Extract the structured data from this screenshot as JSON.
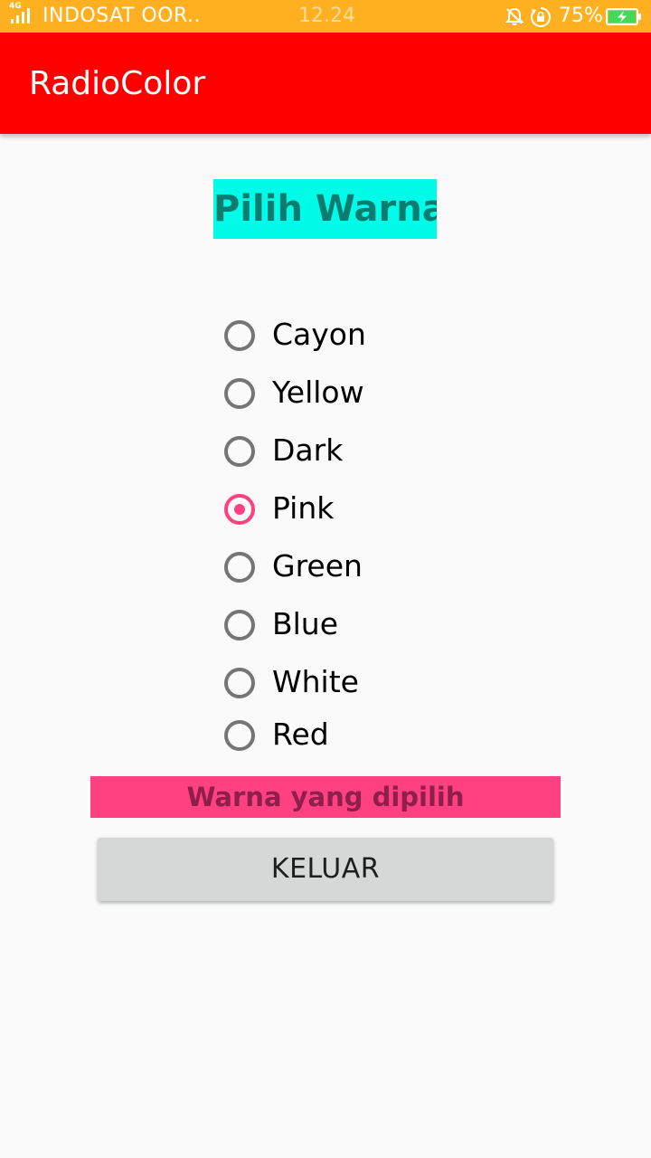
{
  "status_bar": {
    "network_type": "4G",
    "carrier": "INDOSAT OOR..",
    "time": "12.24",
    "battery_percent": "75%",
    "battery_level": 0.75,
    "background_color": "#ffb020",
    "icons": [
      "signal-icon",
      "bell-off-icon",
      "rotation-lock-icon",
      "battery-charging-icon"
    ]
  },
  "app_bar": {
    "title": "RadioColor",
    "background_color": "#ff0000"
  },
  "heading": {
    "text": "Pilih Warna",
    "background_color": "#00fbe8",
    "text_color": "#0a7d70"
  },
  "radio_group": {
    "selected": "Pink",
    "accent_color": "#ff4081",
    "options": [
      {
        "label": "Cayon",
        "checked": false
      },
      {
        "label": "Yellow",
        "checked": false
      },
      {
        "label": "Dark",
        "checked": false
      },
      {
        "label": "Pink",
        "checked": true
      },
      {
        "label": "Green",
        "checked": false
      },
      {
        "label": "Blue",
        "checked": false
      },
      {
        "label": "White",
        "checked": false
      },
      {
        "label": "Red",
        "checked": false
      }
    ]
  },
  "result": {
    "text": "Warna yang dipilih",
    "background_color": "#ff4081"
  },
  "button": {
    "label": "KELUAR"
  }
}
